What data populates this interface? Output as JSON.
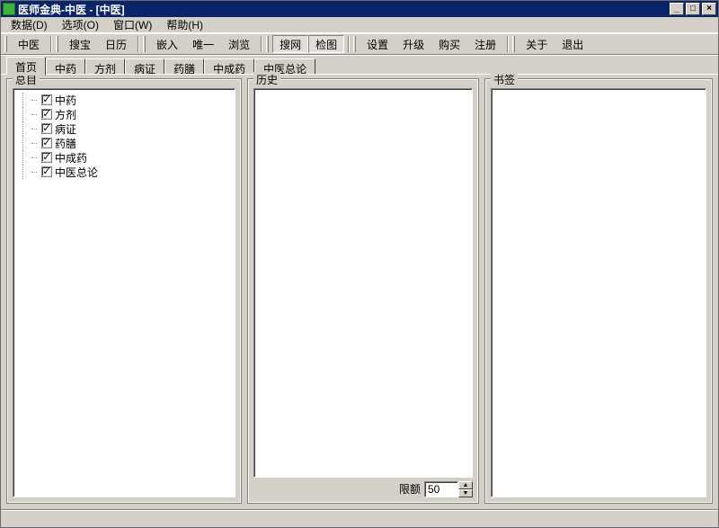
{
  "title": "医师金典-中医 - [中医]",
  "menu": {
    "data": "数据(D)",
    "options": "选项(O)",
    "window": "窗口(W)",
    "help": "帮助(H)"
  },
  "toolbar": [
    {
      "key": "tcm",
      "label": "中医",
      "pressed": false
    },
    {
      "key": "sep"
    },
    {
      "key": "soubao",
      "label": "搜宝",
      "pressed": false
    },
    {
      "key": "calendar",
      "label": "日历",
      "pressed": false
    },
    {
      "key": "sep"
    },
    {
      "key": "embed",
      "label": "嵌入",
      "pressed": false
    },
    {
      "key": "unique",
      "label": "唯一",
      "pressed": false
    },
    {
      "key": "browse",
      "label": "浏览",
      "pressed": false
    },
    {
      "key": "sep"
    },
    {
      "key": "souwang",
      "label": "搜网",
      "pressed": true
    },
    {
      "key": "jiantu",
      "label": "检图",
      "pressed": true
    },
    {
      "key": "sep"
    },
    {
      "key": "settings",
      "label": "设置",
      "pressed": false
    },
    {
      "key": "upgrade",
      "label": "升级",
      "pressed": false
    },
    {
      "key": "buy",
      "label": "购买",
      "pressed": false
    },
    {
      "key": "register",
      "label": "注册",
      "pressed": false
    },
    {
      "key": "sep"
    },
    {
      "key": "about",
      "label": "关于",
      "pressed": false
    },
    {
      "key": "exit",
      "label": "退出",
      "pressed": false
    }
  ],
  "tabs": {
    "items": [
      "首页",
      "中药",
      "方剂",
      "病证",
      "药膳",
      "中成药",
      "中医总论"
    ],
    "active_index": 0
  },
  "panels": {
    "left": "总目",
    "mid": "历史",
    "right": "书签"
  },
  "tree": {
    "items": [
      {
        "label": "中药",
        "checked": true
      },
      {
        "label": "方剂",
        "checked": true
      },
      {
        "label": "病证",
        "checked": true
      },
      {
        "label": "药膳",
        "checked": true
      },
      {
        "label": "中成药",
        "checked": true
      },
      {
        "label": "中医总论",
        "checked": true
      }
    ]
  },
  "limit": {
    "label": "限额",
    "value": "50"
  },
  "glyphs": {
    "check": "✓",
    "min": "_",
    "max": "□",
    "close": "×",
    "up": "▲",
    "down": "▼"
  }
}
